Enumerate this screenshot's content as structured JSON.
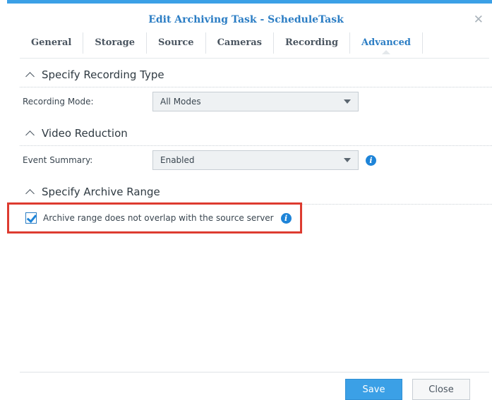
{
  "dialog": {
    "title": "Edit Archiving Task - ScheduleTask",
    "close_glyph": "✕"
  },
  "tabs": [
    {
      "label": "General",
      "active": false
    },
    {
      "label": "Storage",
      "active": false
    },
    {
      "label": "Source",
      "active": false
    },
    {
      "label": "Cameras",
      "active": false
    },
    {
      "label": "Recording",
      "active": false
    },
    {
      "label": "Advanced",
      "active": true
    }
  ],
  "sections": {
    "recording_type": {
      "title": "Specify Recording Type",
      "mode_label": "Recording Mode:",
      "mode_value": "All Modes"
    },
    "video_reduction": {
      "title": "Video Reduction",
      "summary_label": "Event Summary:",
      "summary_value": "Enabled"
    },
    "archive_range": {
      "title": "Specify Archive Range",
      "checkbox_label": "Archive range does not overlap with the source server",
      "checked": true
    }
  },
  "footer": {
    "save_label": "Save",
    "close_label": "Close"
  },
  "colors": {
    "accent": "#3ba0e6",
    "title_blue": "#2b7dc4",
    "highlight_red": "#dd3b30"
  },
  "icons": {
    "info": "i"
  }
}
